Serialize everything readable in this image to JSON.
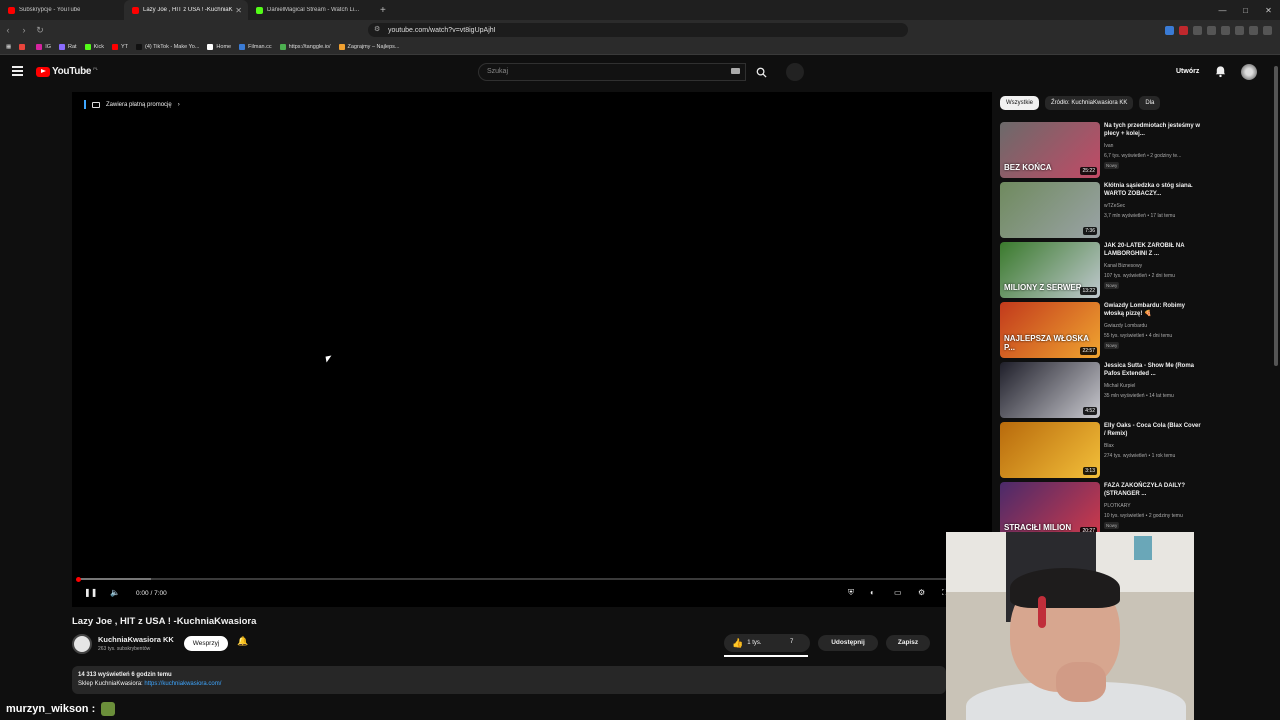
{
  "browser": {
    "tabs": [
      {
        "label": "Subskrypcje - YouTube",
        "color": "#ff0000"
      },
      {
        "label": "Lazy Joe , HIT z USA ! -KuchniaK",
        "color": "#ff0000"
      },
      {
        "label": "DanielMagical Stream - Watch Li...",
        "color": "#53fc18"
      }
    ],
    "url": "youtube.com/watch?v=vt8igUpAjhI",
    "bookmarks": [
      {
        "label": "",
        "color": "#e8453c"
      },
      {
        "label": "IG",
        "color": "#d6249f"
      },
      {
        "label": "Rat",
        "color": "#8a6cff"
      },
      {
        "label": "Kick",
        "color": "#53fc18"
      },
      {
        "label": "YT",
        "color": "#ff0000"
      },
      {
        "label": "(4) TikTok - Make Yo...",
        "color": "#111111"
      },
      {
        "label": "Home",
        "color": "#ffffff"
      },
      {
        "label": "Filman.cc",
        "color": "#3a7bd5"
      },
      {
        "label": "https://tanggle.io/",
        "color": "#4caf50"
      },
      {
        "label": "Zagrajmy – Najleps...",
        "color": "#f0a030"
      }
    ]
  },
  "masthead": {
    "logo_text": "YouTube",
    "country": "PL",
    "search_placeholder": "Szukaj",
    "create_label": "Utwórz"
  },
  "player": {
    "promo_label": "Zawiera płatną promocję",
    "time": "0:00 / 7:00",
    "progress_fraction": 0.0,
    "buffer_fraction": 0.08
  },
  "video": {
    "title": "Lazy Joe , HIT z USA ! -KuchniaKwasiora",
    "channel": "KuchniaKwasiora KK",
    "subscribers": "263 tys. subskrybentów",
    "support_label": "Wesprzyj",
    "likes": "1 tys.",
    "dislikes": "7",
    "share_label": "Udostępnij",
    "save_label": "Zapisz",
    "views": "14 313 wyświetleń  6 godzin temu",
    "shop_label": "Sklep KuchniaKwasiora:",
    "shop_link": "https://kuchniakwasiora.com/"
  },
  "chat": {
    "user": "murzyn_wikson :"
  },
  "sidebar": {
    "chips": [
      {
        "label": "Wszystkie",
        "active": true
      },
      {
        "label": "Źródło: KuchniaKwasiora KK",
        "active": false
      },
      {
        "label": "Dla",
        "active": false
      }
    ],
    "videos": [
      {
        "title": "Na tych przedmiotach jesteśmy w plecy + kolej...",
        "channel": "Ivan",
        "meta": "6,7 tys. wyświetleń • 2 godziny te...",
        "badge": "Nowy",
        "duration": "25:22",
        "thumb_text": "BEZ KOŃCA",
        "colors": [
          "#6b6a6a",
          "#c24a66"
        ]
      },
      {
        "title": "Kłótnia sąsiedzka o stóg siana. WARTO ZOBACZY...",
        "channel": "wTZeSec",
        "meta": "3,7 mln wyświetleń • 17 lat temu",
        "badge": "",
        "duration": "7:36",
        "thumb_text": "",
        "colors": [
          "#6f8a5e",
          "#9aa3a6"
        ]
      },
      {
        "title": "JAK 20-LATEK ZAROBIŁ NA LAMBORGHINI Z ...",
        "channel": "Kanał Biznesowy",
        "meta": "107 tys. wyświetleń • 2 dni temu",
        "badge": "Nowy",
        "duration": "13:22",
        "thumb_text": "MILIONY Z SERWER",
        "colors": [
          "#3a7a2c",
          "#c0c8cf"
        ]
      },
      {
        "title": "Gwiazdy Lombardu: Robimy włoską pizzę! 🍕",
        "channel": "Gwiazdy Lombardu",
        "meta": "55 tys. wyświetleń • 4 dni temu",
        "badge": "Nowy",
        "duration": "22:57",
        "thumb_text": "NAJLEPSZA WŁOSKA P...",
        "colors": [
          "#c23a1c",
          "#f0a530"
        ]
      },
      {
        "title": "Jessica Sutta - Show Me (Roma Pafos Extended ...",
        "channel": "Michał Kurpiel",
        "meta": "35 mln wyświetleń • 14 lat temu",
        "badge": "",
        "duration": "4:52",
        "thumb_text": "",
        "colors": [
          "#1f1f2a",
          "#c9c9cf"
        ]
      },
      {
        "title": "Elly Oaks - Coca Cola (Blax Cover / Remix)",
        "channel": "Blax",
        "meta": "274 tys. wyświetleń • 1 rok temu",
        "badge": "",
        "duration": "3:13",
        "thumb_text": "",
        "colors": [
          "#b86a0c",
          "#f3c03a"
        ]
      },
      {
        "title": "FAZA ZAKOŃCZYŁA DAILY? (STRANGER ...",
        "channel": "PLOTKARY",
        "meta": "10 tys. wyświetleń • 2 godziny temu",
        "badge": "Nowy",
        "duration": "20:27",
        "thumb_text": "STRACIŁI MILION",
        "colors": [
          "#4a2a6a",
          "#d03a4a"
        ]
      }
    ]
  }
}
